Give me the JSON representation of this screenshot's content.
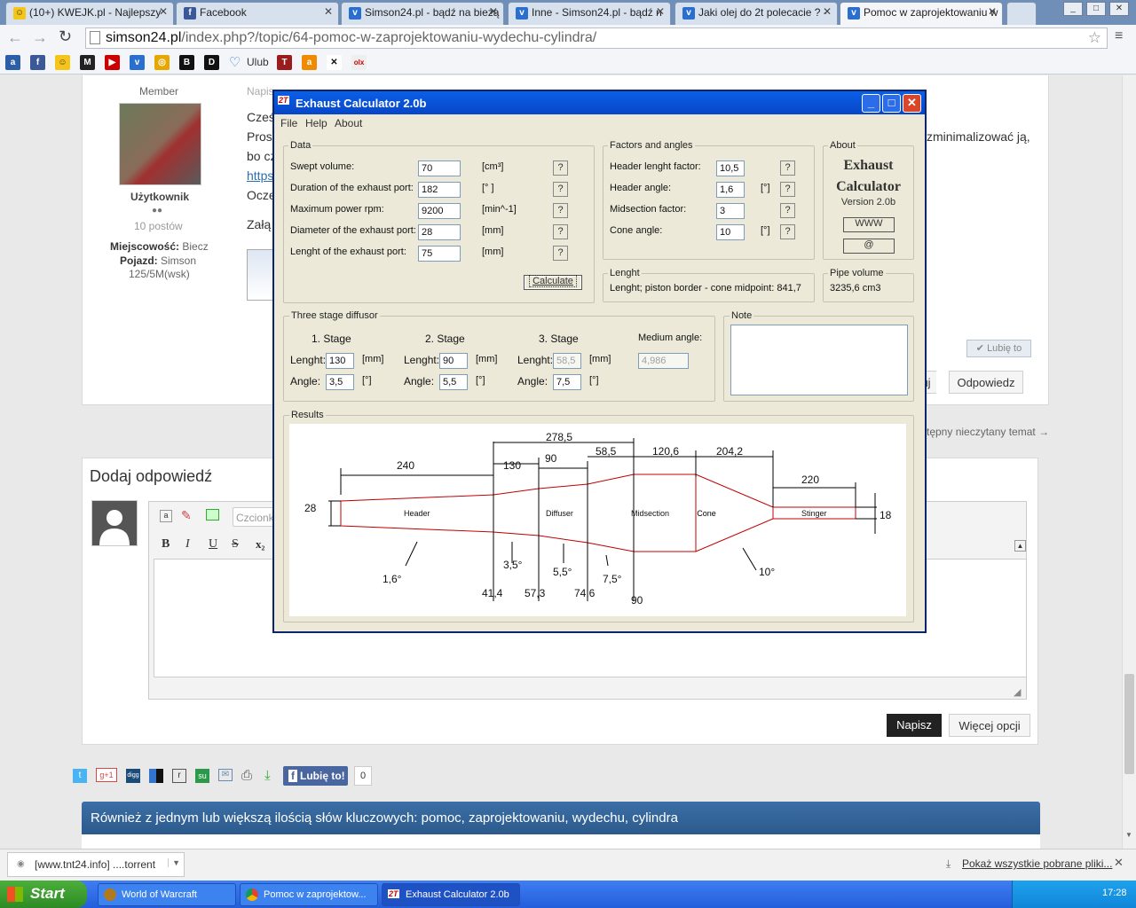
{
  "browser": {
    "tabs": [
      {
        "label": "(10+) KWEJK.pl - Najlepszy",
        "icon": "smiley-icon"
      },
      {
        "label": "Facebook",
        "icon": "facebook-icon"
      },
      {
        "label": "Simson24.pl - bądź na bieżą",
        "icon": "simson-icon"
      },
      {
        "label": "Inne - Simson24.pl - bądź n",
        "icon": "simson-icon"
      },
      {
        "label": "Jaki olej do 2t polecacie ? -",
        "icon": "simson-icon"
      },
      {
        "label": "Pomoc w zaprojektowaniu w",
        "icon": "simson-icon"
      }
    ],
    "url_host": "simson24.pl",
    "url_path": "/index.php?/topic/64-pomoc-w-zaprojektowaniu-wydechu-cylindra/",
    "bookmarks": [
      "Ulub"
    ]
  },
  "post": {
    "member_label": "Member",
    "rank": "Użytkownik",
    "posts": "10 postów",
    "location_label": "Miejscowość:",
    "location": "Biecz",
    "vehicle_label": "Pojazd:",
    "vehicle": "Simson",
    "vehicle_model": "125/5M(wsk)",
    "posted_prefix": "Napis",
    "text_1": "Cześ",
    "text_2": "Pros",
    "text_2_tail": "zminimalizować ją,",
    "text_3": "bo cz",
    "text_4": "https",
    "text_5": "Ocze",
    "attach": "Załą",
    "like": "Lubię to",
    "quote_tail": "uj",
    "reply": "Odpowiedz",
    "next_unread": "tępny nieczytany temat →"
  },
  "reply": {
    "title": "Dodaj odpowiedź",
    "font_placeholder": "Czcionka",
    "submit": "Napisz",
    "more": "Więcej opcji"
  },
  "share": {
    "like_fb": "Lubię to!",
    "count": "0"
  },
  "keywords": "Również z jednym lub większą ilością słów kluczowych: pomoc, zaprojektowaniu, wydechu, cylindra",
  "dialog": {
    "title": "Exhaust Calculator 2.0b",
    "icon_text": "2T",
    "menu": [
      "File",
      "Help",
      "About"
    ],
    "data_group": "Data",
    "data_rows": [
      {
        "label": "Swept volume:",
        "value": "70",
        "unit": "[cm³]"
      },
      {
        "label": "Duration of the exhaust port:",
        "value": "182",
        "unit": "[° ]"
      },
      {
        "label": "Maximum power rpm:",
        "value": "9200",
        "unit": "[min^-1]"
      },
      {
        "label": "Diameter of the exhaust port:",
        "value": "28",
        "unit": "[mm]"
      },
      {
        "label": "Lenght of the exhaust port:",
        "value": "75",
        "unit": "[mm]"
      }
    ],
    "q": "?",
    "calculate": "Calculate",
    "factors_group": "Factors and angles",
    "factor_rows": [
      {
        "label": "Header lenght factor:",
        "value": "10,5",
        "unit": ""
      },
      {
        "label": "Header angle:",
        "value": "1,6",
        "unit": "[°]"
      },
      {
        "label": "Midsection factor:",
        "value": "3",
        "unit": ""
      },
      {
        "label": "Cone angle:",
        "value": "10",
        "unit": "[°]"
      }
    ],
    "about_group": "About",
    "about_title": "Exhaust Calculator",
    "about_version": "Version 2.0b",
    "www": "WWW",
    "at": "@",
    "length_group": "Lenght",
    "length_text": "Lenght; piston border - cone midpoint:  841,7",
    "pipe_group": "Pipe volume",
    "pipe_text": "3235,6 cm3",
    "diffuser_group": "Three stage diffusor",
    "stages": [
      {
        "title": "1. Stage",
        "length": "130",
        "angle": "3,5"
      },
      {
        "title": "2. Stage",
        "length": "90",
        "angle": "5,5"
      },
      {
        "title": "3. Stage",
        "length": "58,5",
        "angle": "7,5"
      }
    ],
    "lenght_label": "Lenght:",
    "angle_label": "Angle:",
    "mm": "[mm]",
    "deg": "[°]",
    "medium_angle_label": "Medium angle:",
    "medium_angle": "4,986",
    "note_group": "Note",
    "results_group": "Results",
    "diagram": {
      "sections": [
        "Header",
        "Diffuser",
        "Midsection",
        "Cone",
        "Stinger"
      ],
      "dims_top": [
        "240",
        "130",
        "90",
        "278,5",
        "58,5",
        "120,6",
        "204,2",
        "220"
      ],
      "dia_in": "28",
      "dia_out": "18",
      "angles": [
        "1,6°",
        "3,5°",
        "5,5°",
        "7,5°",
        "10°"
      ],
      "diameters": [
        "41,4",
        "57,3",
        "74,6",
        "90"
      ]
    }
  },
  "downloads": {
    "file": "[www.tnt24.info] ....torrent",
    "show_all": "Pokaż wszystkie pobrane pliki..."
  },
  "taskbar": {
    "start": "Start",
    "items": [
      "World of Warcraft",
      "Pomoc w zaprojektow...",
      "Exhaust Calculator 2.0b"
    ],
    "clock": "17:28"
  }
}
